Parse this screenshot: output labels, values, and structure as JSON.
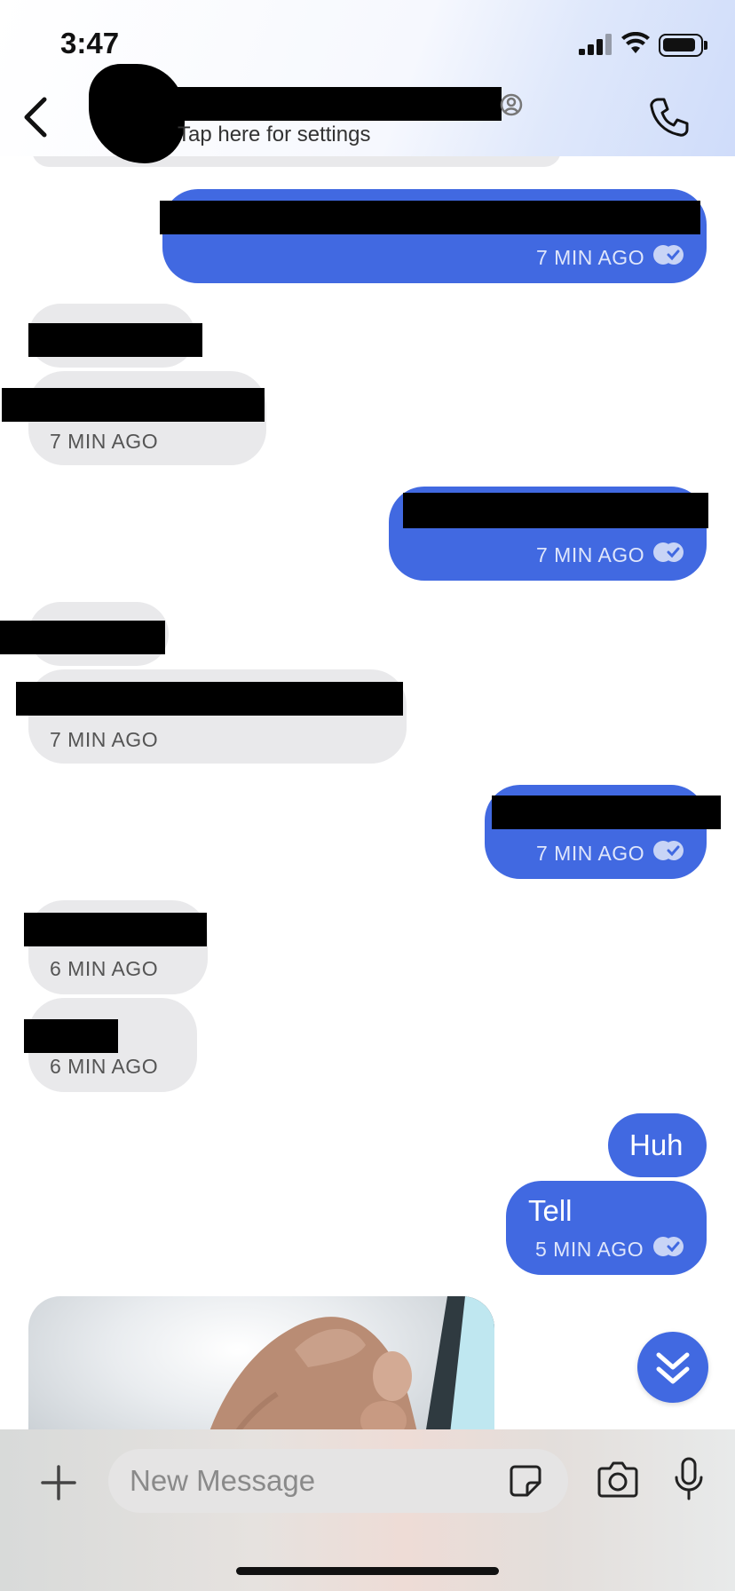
{
  "status_bar": {
    "time": "3:47"
  },
  "header": {
    "subtitle": "Tap here for settings"
  },
  "messages": [
    {
      "direction": "outgoing",
      "time": "7 MIN AGO"
    },
    {
      "direction": "incoming",
      "time": "7 MIN AGO"
    },
    {
      "direction": "outgoing",
      "time": "7 MIN AGO"
    },
    {
      "direction": "incoming",
      "time": "7 MIN AGO"
    },
    {
      "direction": "outgoing",
      "time": "7 MIN AGO"
    },
    {
      "direction": "incoming",
      "time": "6 MIN AGO"
    },
    {
      "direction": "incoming",
      "time": "6 MIN AGO"
    },
    {
      "direction": "outgoing",
      "text": "Huh"
    },
    {
      "direction": "outgoing",
      "text": "Tell",
      "time": "5 MIN AGO"
    }
  ],
  "composer": {
    "placeholder": "New Message"
  },
  "colors": {
    "outgoing_bubble": "#4169e1",
    "incoming_bubble": "#e9e9eb"
  }
}
